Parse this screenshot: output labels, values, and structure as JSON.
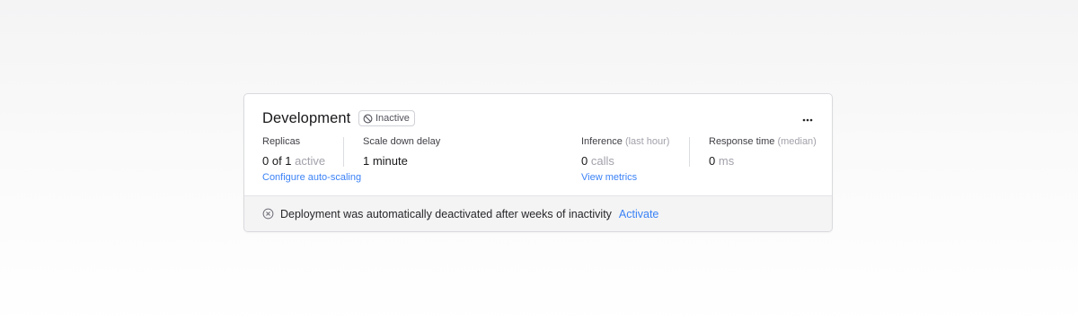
{
  "deployment": {
    "name": "Development",
    "status": "Inactive",
    "status_icon": "prohibited-icon",
    "menu_icon": "more-horizontal-icon"
  },
  "stats": {
    "replicas": {
      "label": "Replicas",
      "value_prefix": "0 of 1",
      "value_suffix": "active",
      "link": "Configure auto-scaling"
    },
    "scale_down": {
      "label": "Scale down delay",
      "value": "1 minute"
    },
    "inference": {
      "label": "Inference",
      "qualifier": "(last hour)",
      "value": "0",
      "unit": "calls",
      "link": "View metrics"
    },
    "response_time": {
      "label": "Response time",
      "qualifier": "(median)",
      "value": "0",
      "unit": "ms"
    }
  },
  "notice": {
    "icon": "circle-x-icon",
    "message": "Deployment was automatically deactivated after weeks of inactivity",
    "action": "Activate"
  },
  "colors": {
    "accent": "#3b82f6",
    "muted": "#a1a1aa"
  }
}
